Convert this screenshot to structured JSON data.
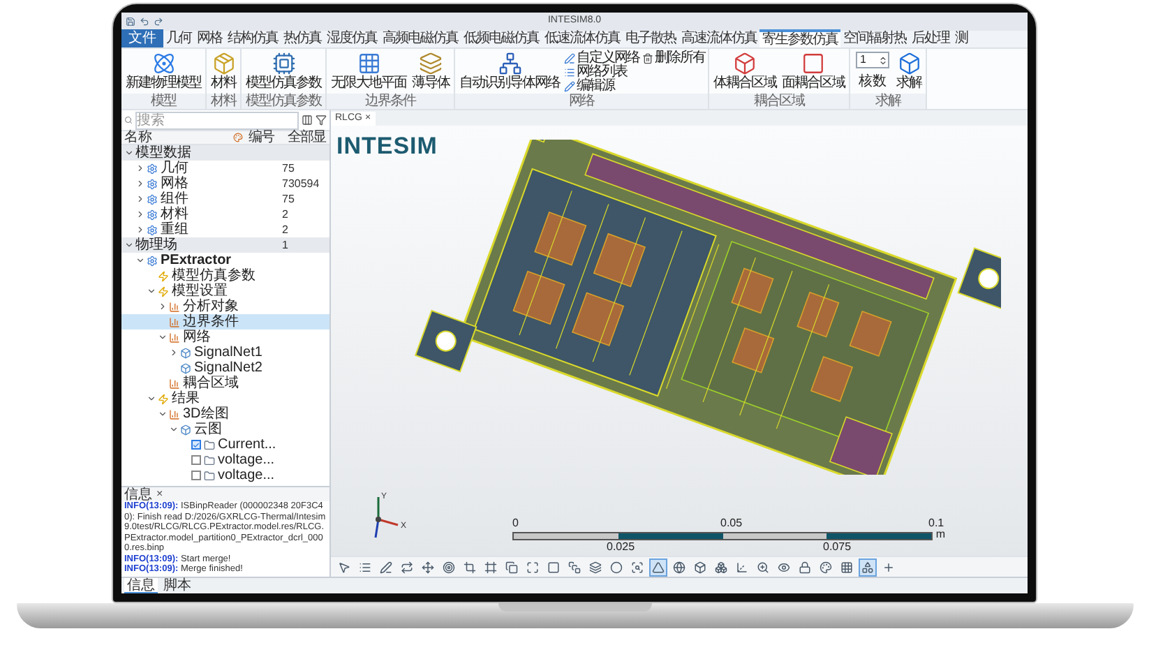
{
  "window": {
    "title": "INTESIM8.0"
  },
  "file_menu": "文件",
  "tabs": [
    {
      "label": "几何",
      "selected": false
    },
    {
      "label": "网格",
      "selected": false
    },
    {
      "label": "结构仿真",
      "selected": false
    },
    {
      "label": "热仿真",
      "selected": false
    },
    {
      "label": "湿度仿真",
      "selected": false
    },
    {
      "label": "高频电磁仿真",
      "selected": false
    },
    {
      "label": "低频电磁仿真",
      "selected": false
    },
    {
      "label": "低速流体仿真",
      "selected": false
    },
    {
      "label": "电子散热",
      "selected": false
    },
    {
      "label": "高速流体仿真",
      "selected": false
    },
    {
      "label": "寄生参数仿真",
      "selected": true
    },
    {
      "label": "空间辐射热",
      "selected": false
    },
    {
      "label": "后处理",
      "selected": false
    },
    {
      "label": "测",
      "selected": false
    }
  ],
  "ribbon": [
    {
      "label": "模型",
      "items": [
        {
          "kind": "large",
          "label": "新建物理模型"
        }
      ]
    },
    {
      "label": "材料",
      "items": [
        {
          "kind": "large",
          "label": "材料"
        }
      ]
    },
    {
      "label": "模型仿真参数",
      "items": [
        {
          "kind": "large",
          "label": "模型仿真参数"
        }
      ]
    },
    {
      "label": "边界条件",
      "items": [
        {
          "kind": "large",
          "label": "无限大地平面"
        },
        {
          "kind": "large",
          "label": "薄导体"
        }
      ]
    },
    {
      "label": "网络",
      "items": [
        {
          "kind": "large",
          "label": "自动识别导体网络"
        },
        {
          "kind": "small",
          "label": "自定义网络"
        },
        {
          "kind": "small",
          "label": "网络列表"
        },
        {
          "kind": "small",
          "label": "编辑源"
        },
        {
          "kind": "small",
          "label": "删除所有"
        }
      ]
    },
    {
      "label": "耦合区域",
      "items": [
        {
          "kind": "large",
          "label": "体耦合区域"
        },
        {
          "kind": "large",
          "label": "面耦合区域"
        }
      ]
    },
    {
      "label": "求解",
      "items": [
        {
          "kind": "spin",
          "label": "核数",
          "value": "1"
        },
        {
          "kind": "large",
          "label": "求解"
        }
      ]
    }
  ],
  "search": {
    "placeholder": "搜索"
  },
  "tree": {
    "columns": [
      "名称",
      "编号",
      "全部显"
    ],
    "nodes": [
      {
        "label": "模型数据",
        "expanded": true,
        "selected": false,
        "children": [
          {
            "label": "几何",
            "value": "75",
            "expanded": false,
            "selected": false
          },
          {
            "label": "网格",
            "value": "730594",
            "expanded": false,
            "selected": false
          },
          {
            "label": "组件",
            "value": "75",
            "expanded": false,
            "selected": false
          },
          {
            "label": "材料",
            "value": "2",
            "expanded": false,
            "selected": false
          },
          {
            "label": "重组",
            "value": "2",
            "expanded": false,
            "selected": false
          }
        ]
      },
      {
        "label": "物理场",
        "value": "1",
        "expanded": true,
        "selected": false,
        "children": [
          {
            "label": "PExtractor",
            "expanded": true,
            "selected": false,
            "children": [
              {
                "label": "模型仿真参数",
                "selected": false
              },
              {
                "label": "模型设置",
                "expanded": true,
                "selected": false,
                "children": [
                  {
                    "label": "分析对象",
                    "expanded": false,
                    "selected": false
                  },
                  {
                    "label": "边界条件",
                    "selected": true
                  },
                  {
                    "label": "网络",
                    "expanded": true,
                    "selected": false,
                    "children": [
                      {
                        "label": "SignalNet1",
                        "expanded": false,
                        "selected": false
                      },
                      {
                        "label": "SignalNet2",
                        "selected": false
                      }
                    ]
                  },
                  {
                    "label": "耦合区域",
                    "selected": false
                  }
                ]
              },
              {
                "label": "结果",
                "expanded": true,
                "selected": false,
                "children": [
                  {
                    "label": "3D绘图",
                    "expanded": true,
                    "selected": false,
                    "children": [
                      {
                        "label": "云图",
                        "expanded": true,
                        "selected": false,
                        "children": [
                          {
                            "label": "Current...",
                            "checked": true,
                            "selected": false
                          },
                          {
                            "label": "voltage...",
                            "checked": false,
                            "selected": false
                          },
                          {
                            "label": "voltage...",
                            "checked": false,
                            "selected": false
                          }
                        ]
                      }
                    ]
                  }
                ]
              }
            ]
          }
        ]
      }
    ]
  },
  "log": {
    "tab": "信息",
    "close": "×",
    "lines": [
      {
        "tag": "INFO(13:09):",
        "text": "ISBinpReader (000002348 20F3C40): Finish read D:/2026/GXRLCG-Thermal/Intesim9.0test/RLCG/RLCG.PExtractor.model.res/RLCG.PExtractor.model_partition0_PExtractor_dcrl_0000.res.binp"
      },
      {
        "tag": "INFO(13:09):",
        "text": "Start merge!"
      },
      {
        "tag": "INFO(13:09):",
        "text": "Merge finished!"
      }
    ]
  },
  "bottom_tabs": [
    {
      "label": "信息",
      "selected": true
    },
    {
      "label": "脚本",
      "selected": false
    }
  ],
  "view": {
    "tab": "RLCG",
    "close": "×",
    "logo": "INTESIM",
    "axes": [
      "Y",
      "X"
    ],
    "scale_bar": {
      "top_labels": [
        "0",
        "0.05",
        "0.1"
      ],
      "bottom_labels": [
        "0.025",
        "0.075"
      ],
      "unit": "m"
    }
  },
  "view_toolbar": [
    {
      "selected": false
    },
    {
      "selected": false
    },
    {
      "selected": false
    },
    {
      "selected": false
    },
    {
      "selected": false
    },
    {
      "selected": false
    },
    {
      "selected": false
    },
    {
      "selected": false
    },
    {
      "selected": false
    },
    {
      "selected": false
    },
    {
      "selected": false
    },
    {
      "selected": false
    },
    {
      "selected": false
    },
    {
      "selected": false
    },
    {
      "selected": false
    },
    {
      "selected": true
    },
    {
      "selected": false
    },
    {
      "selected": false
    },
    {
      "selected": false
    },
    {
      "selected": false
    },
    {
      "selected": false
    },
    {
      "selected": false
    },
    {
      "selected": false
    },
    {
      "selected": false
    },
    {
      "selected": false
    },
    {
      "selected": true
    },
    {
      "selected": false
    }
  ]
}
